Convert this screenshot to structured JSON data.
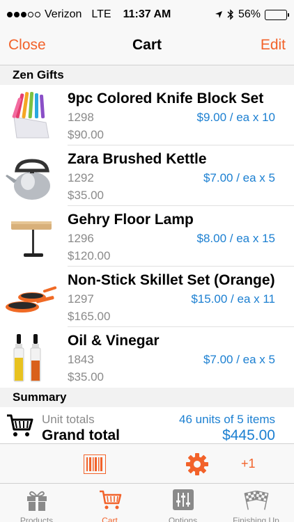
{
  "status": {
    "carrier": "Verizon",
    "network": "LTE",
    "time": "11:37 AM",
    "battery_text": "56%",
    "battery_level": 0.56
  },
  "nav": {
    "close_label": "Close",
    "title": "Cart",
    "edit_label": "Edit"
  },
  "sections": {
    "vendor": "Zen Gifts",
    "summary": "Summary"
  },
  "items": [
    {
      "name": "9pc Colored Knife Block Set",
      "sku": "1298",
      "price": "$9.00 / ea x 10",
      "total": "$90.00",
      "icon": "knife-block-icon"
    },
    {
      "name": "Zara Brushed Kettle",
      "sku": "1292",
      "price": "$7.00 / ea x 5",
      "total": "$35.00",
      "icon": "kettle-icon"
    },
    {
      "name": "Gehry Floor Lamp",
      "sku": "1296",
      "price": "$8.00 / ea x 15",
      "total": "$120.00",
      "icon": "lamp-icon"
    },
    {
      "name": "Non-Stick Skillet Set (Orange)",
      "sku": "1297",
      "price": "$15.00 / ea x 11",
      "total": "$165.00",
      "icon": "skillet-icon"
    },
    {
      "name": "Oil & Vinegar",
      "sku": "1843",
      "price": "$7.00 / ea x 5",
      "total": "$35.00",
      "icon": "oil-vinegar-icon"
    }
  ],
  "summary": {
    "unit_label": "Unit totals",
    "units": "46 units of 5 items",
    "grand_label": "Grand total",
    "grand_value": "$445.00"
  },
  "toolbar": {
    "plus_one": "+1"
  },
  "tabs": [
    {
      "label": "Products",
      "icon": "gift-icon",
      "active": false
    },
    {
      "label": "Cart",
      "icon": "cart-icon",
      "active": true
    },
    {
      "label": "Options",
      "icon": "sliders-icon",
      "active": false
    },
    {
      "label": "Finishing Up",
      "icon": "checkered-flags-icon",
      "active": false
    }
  ],
  "colors": {
    "accent": "#f2622a",
    "link": "#1b7fd1",
    "secondary_text": "#8a8a8a"
  }
}
